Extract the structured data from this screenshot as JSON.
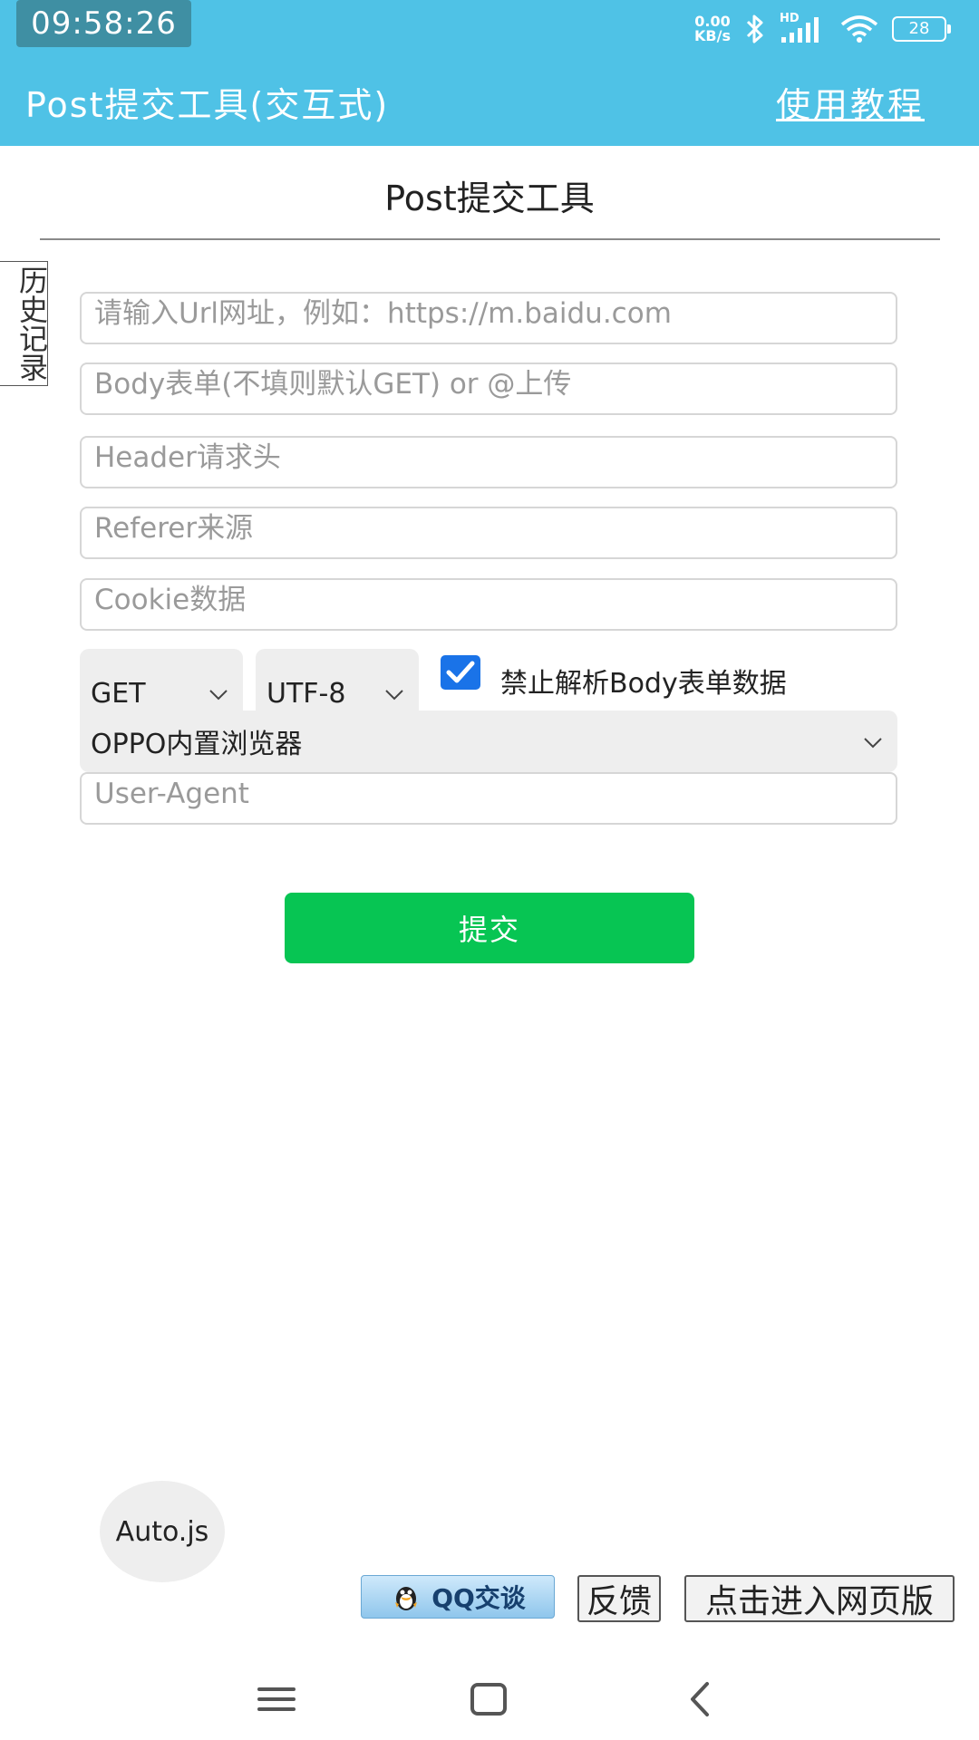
{
  "status": {
    "time": "09:58:26",
    "netspeed_value": "0.00",
    "netspeed_unit": "KB/s",
    "network": "HD",
    "battery": "28"
  },
  "appbar": {
    "title": "Post提交工具(交互式)",
    "help_link": "使用教程"
  },
  "page": {
    "title": "Post提交工具",
    "history_tab": "历史记录"
  },
  "fields": {
    "url_placeholder": "请输入Url网址，例如：https://m.baidu.com",
    "body_placeholder": "Body表单(不填则默认GET) or @上传",
    "header_placeholder": "Header请求头",
    "referer_placeholder": "Referer来源",
    "cookie_placeholder": "Cookie数据",
    "useragent_placeholder": "User-Agent"
  },
  "options": {
    "method": "GET",
    "charset": "UTF-8",
    "disable_parse_checked": true,
    "disable_parse_label": "禁止解析Body表单数据",
    "browser": "OPPO内置浏览器"
  },
  "actions": {
    "submit": "提交"
  },
  "floating": {
    "autojs": "Auto.js"
  },
  "footer": {
    "qq_chat": "QQ交谈",
    "feedback": "反馈",
    "web_version": "点击进入网页版"
  },
  "colors": {
    "appbar": "#4fc2e6",
    "submit": "#07c553",
    "checkbox": "#1a73e8"
  }
}
